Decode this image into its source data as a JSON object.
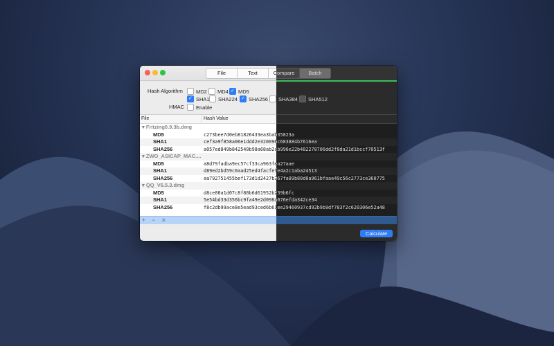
{
  "tabs": [
    {
      "label": "File",
      "selected": false
    },
    {
      "label": "Text",
      "selected": false
    },
    {
      "label": "Compare",
      "selected": false
    },
    {
      "label": "Batch",
      "selected": true
    }
  ],
  "options": {
    "hash_algorithm_label": "Hash Algorithm",
    "hmac_label": "HMAC",
    "algorithms": [
      {
        "name": "MD2",
        "checked": false
      },
      {
        "name": "MD4",
        "checked": false
      },
      {
        "name": "MD5",
        "checked": true
      },
      {
        "name": "SHA1",
        "checked": true
      },
      {
        "name": "SHA224",
        "checked": false
      },
      {
        "name": "SHA256",
        "checked": true
      },
      {
        "name": "SHA384",
        "checked": false
      },
      {
        "name": "SHA512",
        "checked": false
      }
    ],
    "enable": {
      "name": "Enable",
      "checked": false
    }
  },
  "table": {
    "col_file": "File",
    "col_hash": "Hash Value",
    "groups": [
      {
        "name": "Fritzing0.9.3b.dmg",
        "rows": [
          {
            "algo": "MD5",
            "hash": "c273bee7d0eb81826433ea3bab35823a"
          },
          {
            "algo": "SHA1",
            "hash": "cef3a9f858a06e1ddd2e320096c683884b7616ea"
          },
          {
            "algo": "SHA256",
            "hash": "a057ed849b842540b98a68ab2cb996e22b482278706dd2f8da21d1bccf70513f"
          }
        ]
      },
      {
        "name": "ZWO_ASICAP_MAC....",
        "rows": [
          {
            "algo": "MD5",
            "hash": "a8d79fadba9ec57cf33ca963fea27aae"
          },
          {
            "algo": "SHA1",
            "hash": "d89ed2bd59c0aad25ed4facfefe4a2c1aba24513"
          },
          {
            "algo": "SHA256",
            "hash": "aa792751455bef173d1d2427b367fa89b80d0a961bfaae49c56c2773ce360775"
          }
        ]
      },
      {
        "name": "QQ_V6.5.3.dmg",
        "rows": [
          {
            "algo": "MD5",
            "hash": "d8ce00a1d07c8f80b6d61952b239b6fc"
          },
          {
            "algo": "SHA1",
            "hash": "5e54bd33d356bc9fa49e2d098a076efda342ce34"
          },
          {
            "algo": "SHA256",
            "hash": "f8c2db99ace8e5ead93ced6b61ee29460937cd92b9b9df783f2c620306e52a48"
          }
        ]
      }
    ]
  },
  "footer": {
    "add": "+",
    "remove": "−",
    "clear": "✕"
  },
  "calculate_label": "Calculate",
  "colors": {
    "accent": "#2f7cf6",
    "dark_accent": "#3fbf5a"
  }
}
